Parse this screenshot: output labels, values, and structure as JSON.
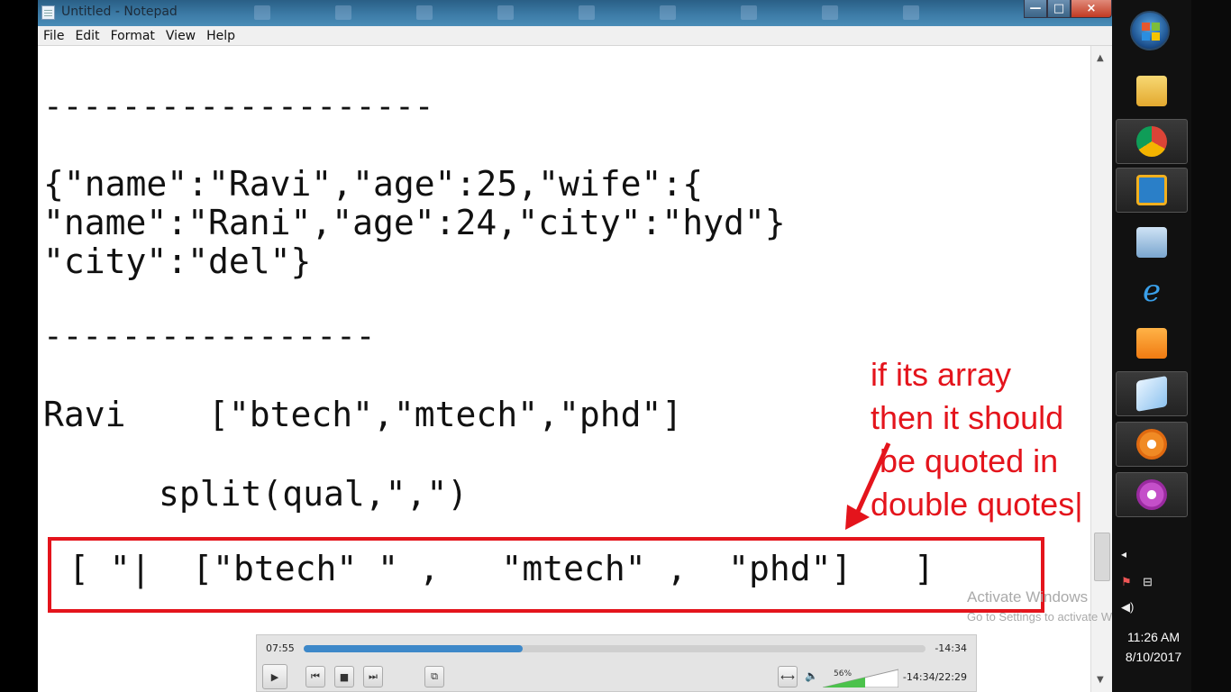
{
  "window": {
    "title": "Untitled - Notepad",
    "close_glyph": "×",
    "min_glyph": "—",
    "max_glyph": "□"
  },
  "menu": [
    "File",
    "Edit",
    "Format",
    "View",
    "Help"
  ],
  "editor": {
    "dashes1": "--------------------",
    "json_line1": "{\"name\":\"Ravi\",\"age\":25,\"wife\":{",
    "json_line2": "\"name\":\"Rani\",\"age\":24,\"city\":\"hyd\"}",
    "json_line3": "\"city\":\"del\"}",
    "dashes2": "-----------------",
    "ravi_line": "Ravi    [\"btech\",\"mtech\",\"phd\"]",
    "split_line": "split(qual,\",\")",
    "boxed_line": "[ \"|  [\"btech\" \" ,   \"mtech\" ,  \"phd\"]   ]"
  },
  "annotation": {
    "line1": "if its array",
    "line2": "then it should",
    "line3": " be quoted in",
    "line4": "double quotes|"
  },
  "watermark": {
    "title": "Activate Windows",
    "subtitle": "Go to Settings to activate Windows."
  },
  "player": {
    "elapsed": "07:55",
    "remaining": "-14:34",
    "progress": 0.352,
    "volume_label": "56%",
    "volume": 0.56,
    "time_display": "-14:34/22:29",
    "buttons": {
      "play": "▶",
      "prev": "⏮",
      "stop": "■",
      "next": "⏭",
      "fullscreen": "⧉",
      "loop": "⟷",
      "speaker": "🔈"
    }
  },
  "taskbar": {
    "icons": [
      "windows-start-icon",
      "folder-icon",
      "chrome-icon",
      "virtualbox-icon",
      "image-viewer-icon",
      "internet-explorer-icon",
      "media-player-icon",
      "notepad-icon",
      "flower-app-icon",
      "flower-app-icon-2"
    ],
    "tray_chevron": "◂",
    "time": "11:26 AM",
    "date": "8/10/2017"
  },
  "colors": {
    "accent_red": "#e4141c",
    "seek_blue": "#3d88c9",
    "volume_green": "#4bc24b"
  }
}
